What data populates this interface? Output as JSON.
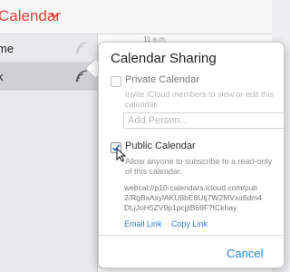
{
  "app": {
    "title": "Calendar",
    "time_label": "11 a.m."
  },
  "sidebar": {
    "items": [
      {
        "label": "me"
      },
      {
        "label": "k"
      }
    ]
  },
  "popover": {
    "title": "Calendar Sharing",
    "private": {
      "label": "Private Calendar",
      "description": [
        "Invite iCloud members to view or edit this",
        "calendar."
      ],
      "add_person_placeholder": "Add Person..."
    },
    "public": {
      "label": "Public Calendar",
      "checked": true,
      "description": [
        "Allow anyone to subscribe to a read-only",
        "of this calendar."
      ],
      "url_lines": [
        "webcal://p10-calendars.icloud.com/pub",
        "2/RgBxAxylAKU8bE8Utj7W2MVxu6dm4",
        "DLjJoH5ZV9p1pcjjtB69F7tCkhay"
      ],
      "email_link": "Email Link",
      "copy_link": "Copy Link"
    },
    "cancel_label": "Cancel"
  },
  "colors": {
    "accent_red": "#e0423a",
    "link_blue": "#2f7dd6"
  },
  "icons": [
    "chevron-down-icon",
    "share-icon",
    "pointer-cursor-icon"
  ]
}
